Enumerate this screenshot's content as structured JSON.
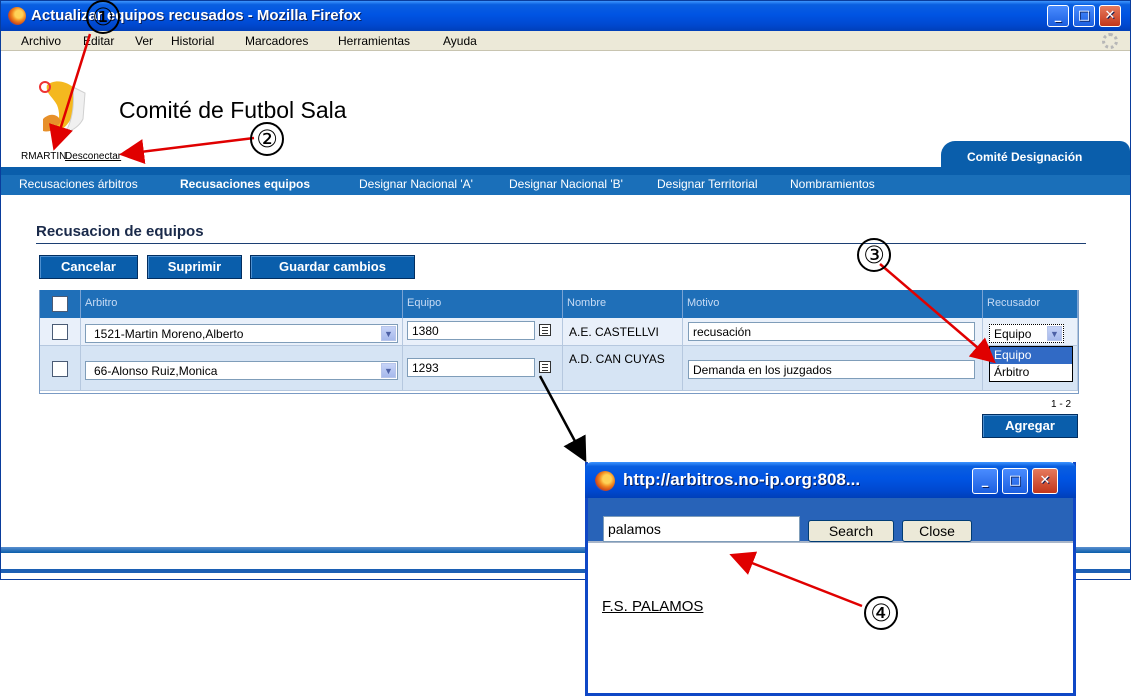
{
  "window": {
    "title": "Actualizar equipos recusados - Mozilla Firefox",
    "minimize": "_",
    "maximize": "□",
    "close": "✕"
  },
  "menu": [
    "Archivo",
    "Editar",
    "Ver",
    "Historial",
    "Marcadores",
    "Herramientas",
    "Ayuda"
  ],
  "header": {
    "site_title": "Comité de Futbol Sala",
    "user": "RMARTIN",
    "logout": "Desconectar",
    "tab": "Comité Designación"
  },
  "nav": [
    "Recusaciones árbitros",
    "Recusaciones equipos",
    "Designar Nacional 'A'",
    "Designar Nacional 'B'",
    "Designar Territorial",
    "Nombramientos"
  ],
  "page": {
    "title": "Recusacion de equipos",
    "buttons": {
      "cancel": "Cancelar",
      "delete": "Suprimir",
      "save": "Guardar cambios"
    },
    "add": "Agregar",
    "pager": "1 - 2"
  },
  "grid": {
    "columns": [
      "Arbitro",
      "Equipo",
      "Nombre",
      "Motivo",
      "Recusador"
    ],
    "rows": [
      {
        "arbitro": "1521-Martin Moreno,Alberto",
        "equipo": "1380",
        "nombre": "A.E. CASTELLVI",
        "motivo": "recusación",
        "recusador": "Equipo"
      },
      {
        "arbitro": "66-Alonso Ruiz,Monica",
        "equipo": "1293",
        "nombre": "A.D. CAN CUYAS",
        "motivo": "Demanda en los juzgados",
        "recusador": ""
      }
    ],
    "recusador_options": [
      "Equipo",
      "Árbitro"
    ]
  },
  "popup": {
    "title": "http://arbitros.no-ip.org:808...",
    "search_value": "palamos",
    "search_button": "Search",
    "close_button": "Close",
    "result": "F.S. PALAMOS"
  },
  "annotations": [
    "①",
    "②",
    "③",
    "④"
  ],
  "colors": {
    "accent": "#0a5eab",
    "nav": "#1a6fb9",
    "annotation_arrow": "#e00000",
    "xp_title": "#0054e3"
  }
}
